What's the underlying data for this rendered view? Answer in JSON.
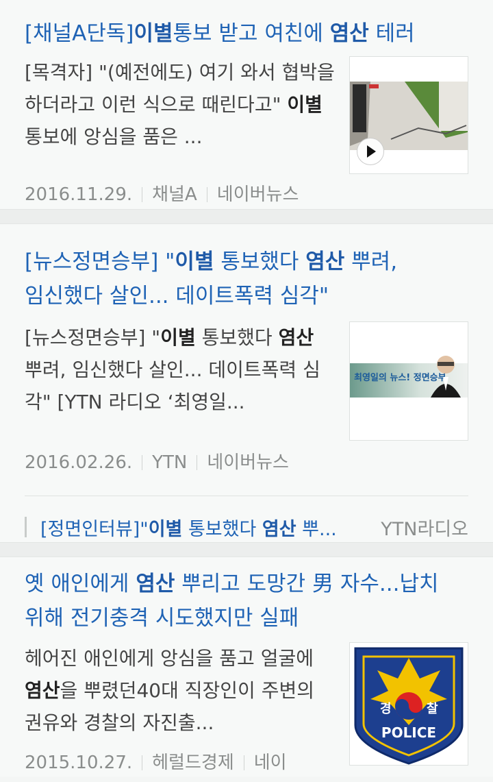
{
  "articles": [
    {
      "title_parts": [
        "[채널A단독]",
        "이별",
        "통보 받고 여친에 ",
        "염산",
        " 테러"
      ],
      "desc_parts": [
        "[목격자] \"(예전에도) 여기 와서 협박을 하더라고 이런 식으로 때린다고\" ",
        "이별",
        " 통보에 앙심을 품은 ..."
      ],
      "date": "2016.11.29.",
      "source": "채널A",
      "portal": "네이버뉴스"
    },
    {
      "title_parts": [
        "[뉴스정면승부] \"",
        "이별",
        " 통보했다 ",
        "염산",
        " 뿌려, 임신했다 살인... 데이트폭력 심각\""
      ],
      "desc_parts": [
        "[뉴스정면승부] \"",
        "이별",
        " 통보했다 ",
        "염산",
        " 뿌려, 임신했다 살인... 데이트폭력 심각\" [YTN 라디오 ‘최영일..."
      ],
      "date": "2016.02.26.",
      "source": "YTN",
      "portal": "네이버뉴스",
      "thumb_caption": "최영일의 뉴스! 정면승부",
      "related": {
        "title_parts": [
          "[정면인터뷰]\"",
          "이별",
          " 통보했다 ",
          "염산",
          " 뿌..."
        ],
        "source": "YTN라디오"
      }
    },
    {
      "title_parts": [
        "옛 애인에게 ",
        "염산",
        " 뿌리고 도망간 男 자수...납치 위해 전기충격 시도했지만 실패"
      ],
      "desc_parts": [
        "헤어진 애인에게 앙심을 품고 얼굴에 ",
        "염산",
        "을 뿌렸던40대 직장인이 주변의 권유와 경찰의 자진출..."
      ],
      "date": "2015.10.27.",
      "source": "헤럴드경제",
      "portal": "네이",
      "logo_text": [
        "경",
        "찰",
        "POLICE"
      ]
    }
  ],
  "colors": {
    "title": "#1f63b5",
    "meta": "#8a8d8c",
    "background": "#f7f9f8"
  }
}
